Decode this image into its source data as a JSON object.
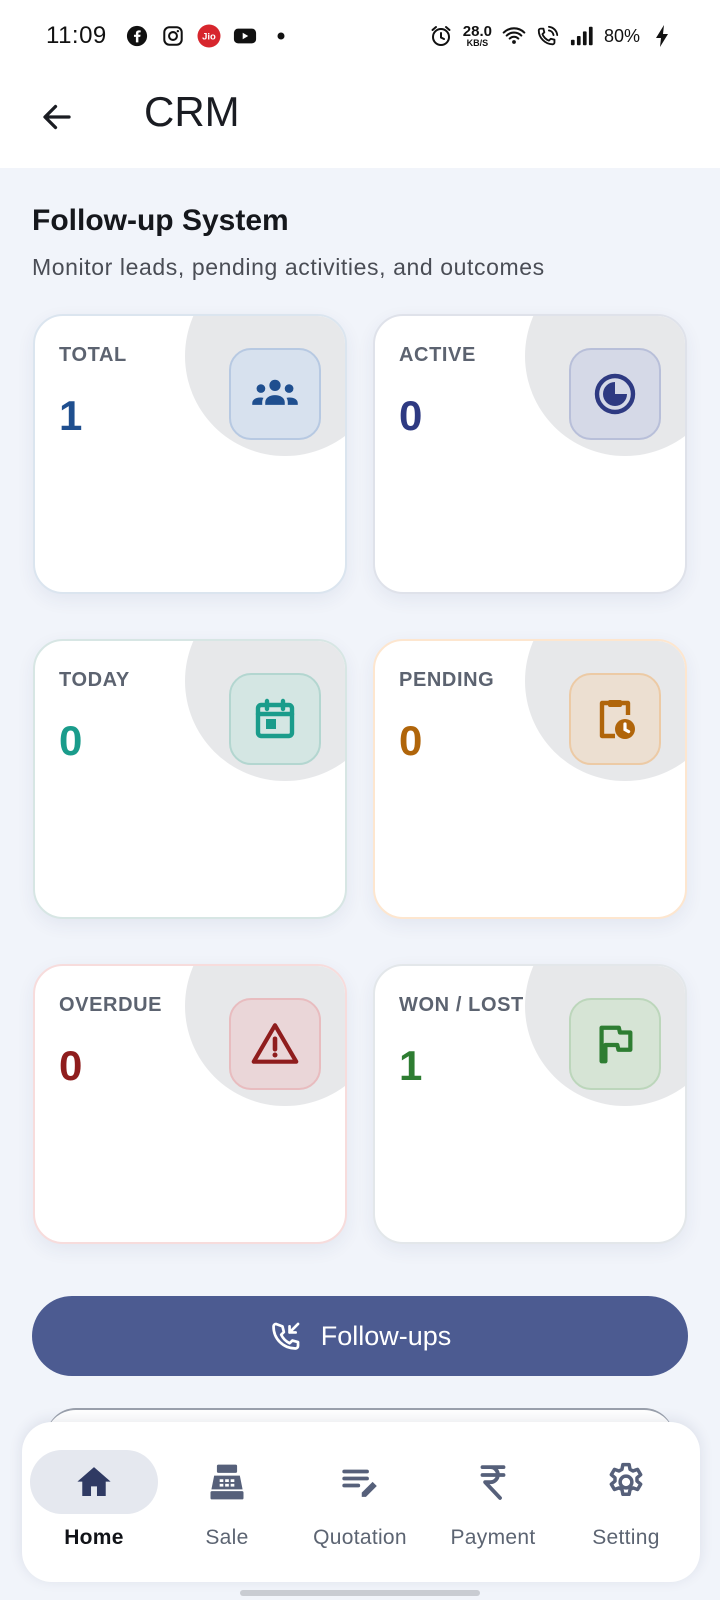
{
  "status_bar": {
    "time": "11:09",
    "speed_value": "28.0",
    "speed_unit": "KB/S",
    "battery": "80%",
    "icons": [
      "facebook-icon",
      "instagram-icon",
      "jio-icon",
      "youtube-icon",
      "dot-icon",
      "alarm-icon",
      "wifi-icon",
      "wifi-call-icon",
      "signal-icon",
      "charging-icon"
    ]
  },
  "app_bar": {
    "title": "CRM"
  },
  "section": {
    "title": "Follow-up System",
    "subtitle": "Monitor leads, pending activities, and outcomes"
  },
  "cards": [
    {
      "label": "TOTAL",
      "value": "1",
      "icon": "group-icon",
      "color": "#1f4f8f",
      "icon_bg": "#d7e1ee",
      "icon_border": "#b7c9e2",
      "border": "#dbe5ef"
    },
    {
      "label": "ACTIVE",
      "value": "0",
      "icon": "pie-icon",
      "color": "#2e3a82",
      "icon_bg": "#d5d9e7",
      "icon_border": "#b8bfd9",
      "border": "#dfe2ea"
    },
    {
      "label": "TODAY",
      "value": "0",
      "icon": "calendar-icon",
      "color": "#1a9c8b",
      "icon_bg": "#d4e6e3",
      "icon_border": "#b3d6d0",
      "border": "#d7e6e4"
    },
    {
      "label": "PENDING",
      "value": "0",
      "icon": "clipboard-clock-icon",
      "color": "#b0650a",
      "icon_bg": "#ecdfd1",
      "icon_border": "#eccaa5",
      "border": "#fde6cf"
    },
    {
      "label": "OVERDUE",
      "value": "0",
      "icon": "warning-icon",
      "color": "#8f1d1d",
      "icon_bg": "#ead6d8",
      "icon_border": "#e8bcbf",
      "border": "#f7dcdc"
    },
    {
      "label": "WON / LOST",
      "value": "1",
      "icon": "flag-icon",
      "color": "#2e7d32",
      "icon_bg": "#d6e4d5",
      "icon_border": "#bcd6bb",
      "border": "#e3e7ea"
    }
  ],
  "follow_button": {
    "label": "Follow-ups",
    "icon": "phone-incoming-icon",
    "color": "#4c5b91"
  },
  "bottom_nav": {
    "items": [
      {
        "label": "Home",
        "icon": "home-icon",
        "active": true
      },
      {
        "label": "Sale",
        "icon": "cash-register-icon",
        "active": false
      },
      {
        "label": "Quotation",
        "icon": "edit-notes-icon",
        "active": false
      },
      {
        "label": "Payment",
        "icon": "rupee-icon",
        "active": false
      },
      {
        "label": "Setting",
        "icon": "gear-icon",
        "active": false
      }
    ]
  }
}
